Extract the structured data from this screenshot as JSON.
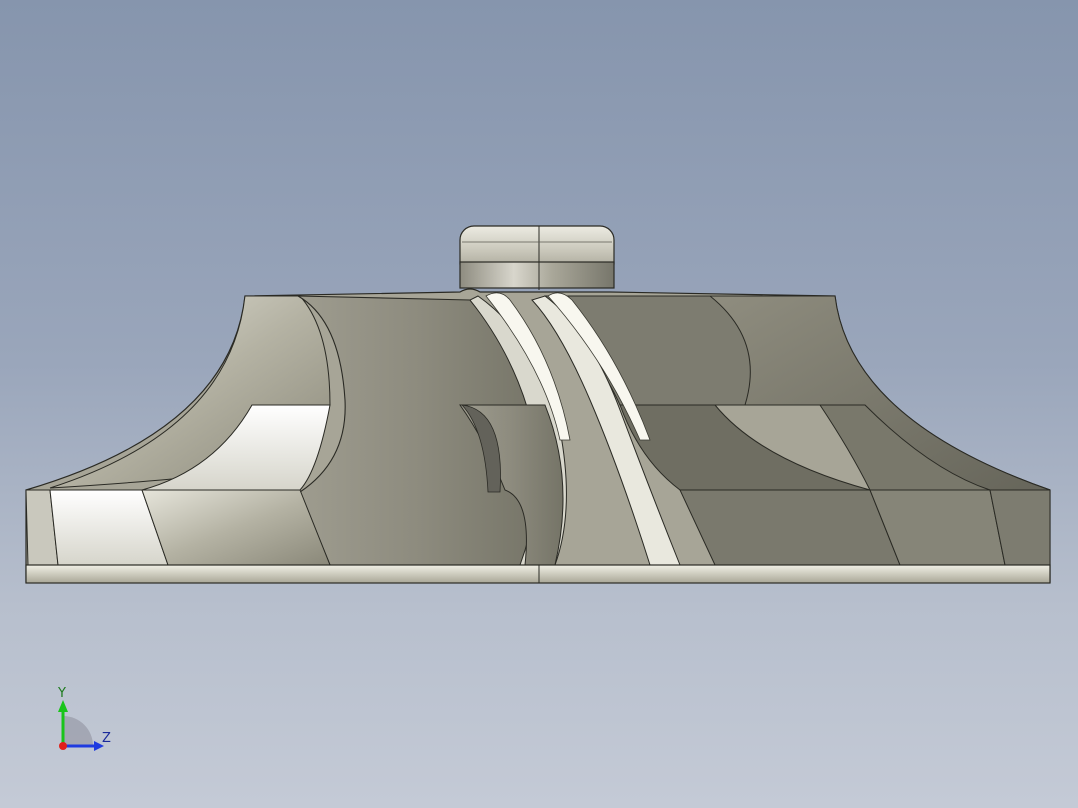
{
  "viewport": {
    "background_top": "#8695ad",
    "background_bottom": "#c4cad6",
    "model": {
      "name": "impeller",
      "color_base": "#b9b7a7",
      "color_shadow": "#6e6d62",
      "color_highlight": "#f4f3ea"
    },
    "triad": {
      "y_label": "Y",
      "z_label": "Z",
      "y_color": "#19c41a",
      "z_color": "#1f3be0",
      "x_color": "#e0201a"
    }
  }
}
